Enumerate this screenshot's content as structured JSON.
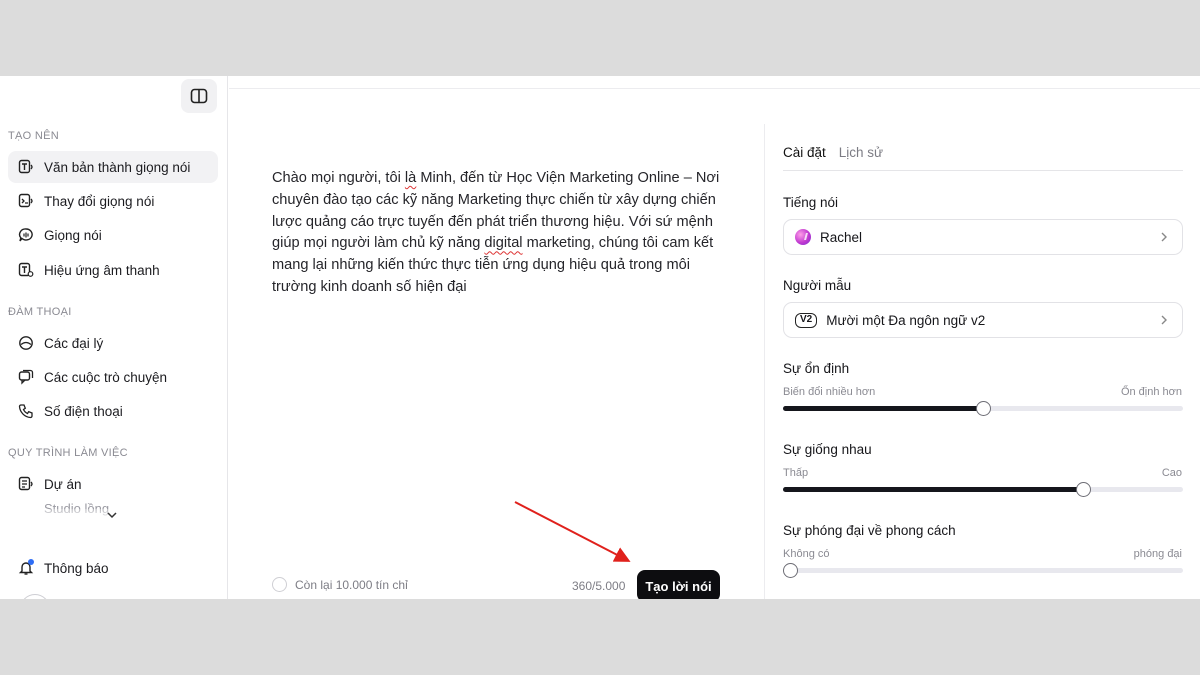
{
  "sidebar": {
    "sections": [
      {
        "title": "TẠO NÊN",
        "items": [
          {
            "label": "Văn bản thành giọng nói",
            "icon": "text-to-speech-icon",
            "active": true
          },
          {
            "label": "Thay đổi giọng nói",
            "icon": "voice-changer-icon"
          },
          {
            "label": "Giọng nói",
            "icon": "voices-icon"
          },
          {
            "label": "Hiệu ứng âm thanh",
            "icon": "sound-effects-icon"
          }
        ]
      },
      {
        "title": "ĐÀM THOẠI",
        "items": [
          {
            "label": "Các đại lý",
            "icon": "agents-icon"
          },
          {
            "label": "Các cuộc trò chuyện",
            "icon": "conversations-icon"
          },
          {
            "label": "Số điện thoại",
            "icon": "phone-icon"
          }
        ]
      },
      {
        "title": "QUY TRÌNH LÀM VIỆC",
        "items": [
          {
            "label": "Dự án",
            "icon": "projects-icon"
          },
          {
            "label": "Studio lồng",
            "icon": "dubbing-studio-icon"
          }
        ]
      }
    ],
    "notifications_label": "Thông báo"
  },
  "editor": {
    "text": "Chào mọi người, tôi là Minh, đến từ Học Viện Marketing Online – Nơi chuyên đào tạo các kỹ năng Marketing thực chiến từ xây dựng chiến lược quảng cáo trực tuyến đến phát triển thương hiệu. Với sứ mệnh giúp mọi người làm chủ kỹ năng digital marketing, chúng tôi cam kết mang lại những kiến thức thực tiễn ứng dụng hiệu quả trong môi trường kinh doanh số hiện đại",
    "credits_remaining": "Còn lại 10.000 tín chỉ",
    "char_count": "360/5.000",
    "generate_label": "Tạo lời nói"
  },
  "settings": {
    "tabs": [
      {
        "label": "Cài đặt",
        "active": true
      },
      {
        "label": "Lịch sử",
        "active": false
      }
    ],
    "voice": {
      "label": "Tiếng nói",
      "value": "Rachel"
    },
    "model": {
      "label": "Người mẫu",
      "badge": "V2",
      "value": "Mười một Đa ngôn ngữ v2"
    },
    "sliders": [
      {
        "label": "Sự ổn định",
        "min_label": "Biến đổi nhiều hơn",
        "max_label": "Ổn định hơn",
        "value": 0.5
      },
      {
        "label": "Sự giống nhau",
        "min_label": "Thấp",
        "max_label": "Cao",
        "value": 0.75
      },
      {
        "label": "Sự phóng đại về phong cách",
        "min_label": "Không có",
        "max_label": "phóng đại",
        "value": 0.0
      }
    ]
  },
  "colors": {
    "accent": "#0d0d10",
    "annotation_arrow": "#e0211c",
    "notification_dot": "#2e6df5"
  }
}
